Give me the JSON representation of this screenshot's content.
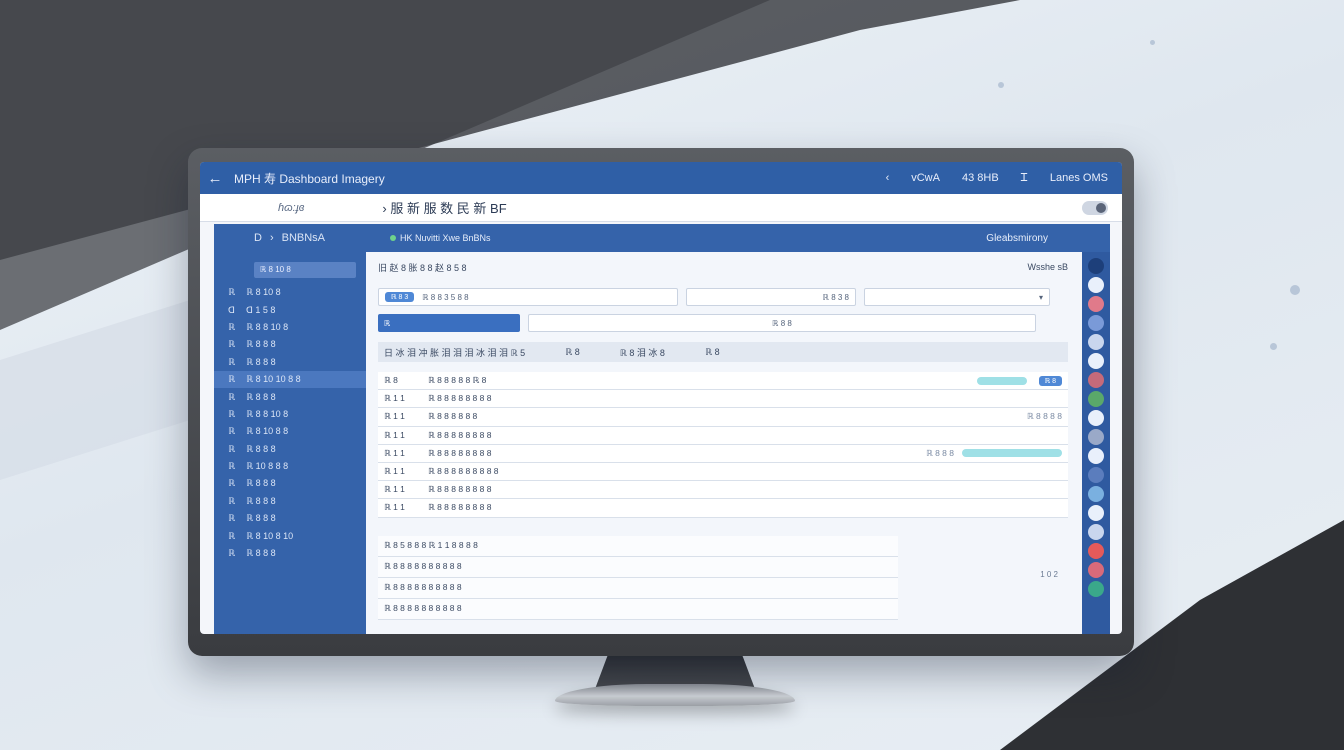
{
  "colors": {
    "title_bar": "#2f5fa6",
    "sidebar": "#3563aa",
    "accent_pill": "#9fe0e6",
    "tag": "#4f88d6"
  },
  "window": {
    "back_icon": "arrow-left-icon",
    "title": "MPH 寿 Dashboard Imagery",
    "right_items": [
      "‹",
      "vCwA",
      "43 8HB",
      "Ꮖ",
      "Lanes OMS"
    ]
  },
  "address": {
    "logo_text": "ɦɷ:ɟɞ",
    "path": "› 服 新 服 数 民 新 BF"
  },
  "sidebar": {
    "head": [
      "D",
      "›",
      "BNBNsA"
    ],
    "search_placeholder": "ℝ 8 10 8",
    "items": [
      {
        "icon": "ℝ",
        "label": "ℝ 8 10 8"
      },
      {
        "icon": "ᗡ",
        "label": "ᗡ 1 5 8"
      },
      {
        "icon": "ℝ",
        "label": "ℝ 8 8 10 8"
      },
      {
        "icon": "ℝ",
        "label": "ℝ 8 8 8"
      },
      {
        "icon": "ℝ",
        "label": "ℝ 8 8 8"
      },
      {
        "icon": "ℝ",
        "label": "ℝ 8 10 10 8 8"
      },
      {
        "icon": "ℝ",
        "label": "ℝ 8 8 8"
      },
      {
        "icon": "ℝ",
        "label": "ℝ 8 8 10 8"
      },
      {
        "icon": "ℝ",
        "label": "ℝ 8 10 8 8"
      },
      {
        "icon": "ℝ",
        "label": "ℝ 8 8 8"
      },
      {
        "icon": "ℝ",
        "label": "ℝ 10 8 8 8"
      },
      {
        "icon": "ℝ",
        "label": "ℝ 8 8 8"
      },
      {
        "icon": "ℝ",
        "label": "ℝ 8 8 8"
      },
      {
        "icon": "ℝ",
        "label": "ℝ 8 8 8"
      },
      {
        "icon": "ℝ",
        "label": "ℝ 8 10 8 10"
      },
      {
        "icon": "ℝ",
        "label": "ℝ 8 8 8"
      }
    ],
    "active_index": 5
  },
  "strip": {
    "status": "HK Nuvitti Xwe BnBNs",
    "right": "Gleabsmirony"
  },
  "content": {
    "crumb_left": "旧 赵 8 胀 8 8 赵 8 5 8",
    "crumb_right": "Wsshe sB",
    "filter_primary": "ℝ 8 3",
    "filter_text": "ℝ 8 8 3 5 8 8",
    "filter_right": "ℝ 8 3 8",
    "filter_select": "▾",
    "action_btn": "ℝ",
    "action_text": "ℝ 8 8",
    "section_cols": [
      "日 冰 泪 冲 胀 泪 泪 泪 冰 泪 泪 ℝ 5",
      "ℝ 8",
      "ℝ 8 泪 冰 8",
      "ℝ 8"
    ],
    "rows": [
      {
        "c1": "ℝ 8",
        "c2": "ℝ 8 8 8 8 8 ℝ 8",
        "c3": "",
        "tag": "ℝ 8"
      },
      {
        "c1": "ℝ 1 1",
        "c2": "ℝ 8 8 8 8 8 8 8 8",
        "c3": "",
        "tag": ""
      },
      {
        "c1": "ℝ 1 1",
        "c2": "ℝ 8 8 8 8 8 8",
        "c3": "ℝ 8 8 8 8",
        "tag": ""
      },
      {
        "c1": "ℝ 1 1",
        "c2": "ℝ 8 8 8 8 8 8 8 8",
        "c3": "",
        "tag": ""
      },
      {
        "c1": "ℝ 1 1",
        "c2": "ℝ 8 8 8 8 8 8 8 8",
        "c3": "ℝ 8 8 8",
        "tag": ""
      },
      {
        "c1": "ℝ 1 1",
        "c2": "ℝ 8 8 8 8 8 8 8 8 8",
        "c3": "",
        "tag": ""
      },
      {
        "c1": "ℝ 1 1",
        "c2": "ℝ 8 8 8 8 8 8 8 8",
        "c3": "",
        "tag": ""
      },
      {
        "c1": "ℝ 1 1",
        "c2": "ℝ 8 8 8 8 8 8 8 8",
        "c3": "",
        "tag": ""
      }
    ],
    "rows2": [
      "ℝ 8 5 8 8 8 ℝ 1 1 8 8 8 8",
      "ℝ 8 8 8 8 8 8 8 8 8 8",
      "ℝ 8 8 8 8 8 8 8 8 8 8",
      "ℝ 8 8 8 8 8 8 8 8 8 8"
    ],
    "page_note": "1 0 2"
  },
  "rail_colors": [
    "#1d3f7a",
    "#e9f0fb",
    "#e07a8a",
    "#7a9ad8",
    "#c9d6ee",
    "#e9f0fb",
    "#c66a7a",
    "#5aa86a",
    "#e9f0fb",
    "#9aa9c8",
    "#e9f0fb",
    "#5b7dbd",
    "#7ab0e0",
    "#e9f0fb",
    "#c9d6ee",
    "#e55a5a",
    "#d86a7a",
    "#3aa88a"
  ]
}
